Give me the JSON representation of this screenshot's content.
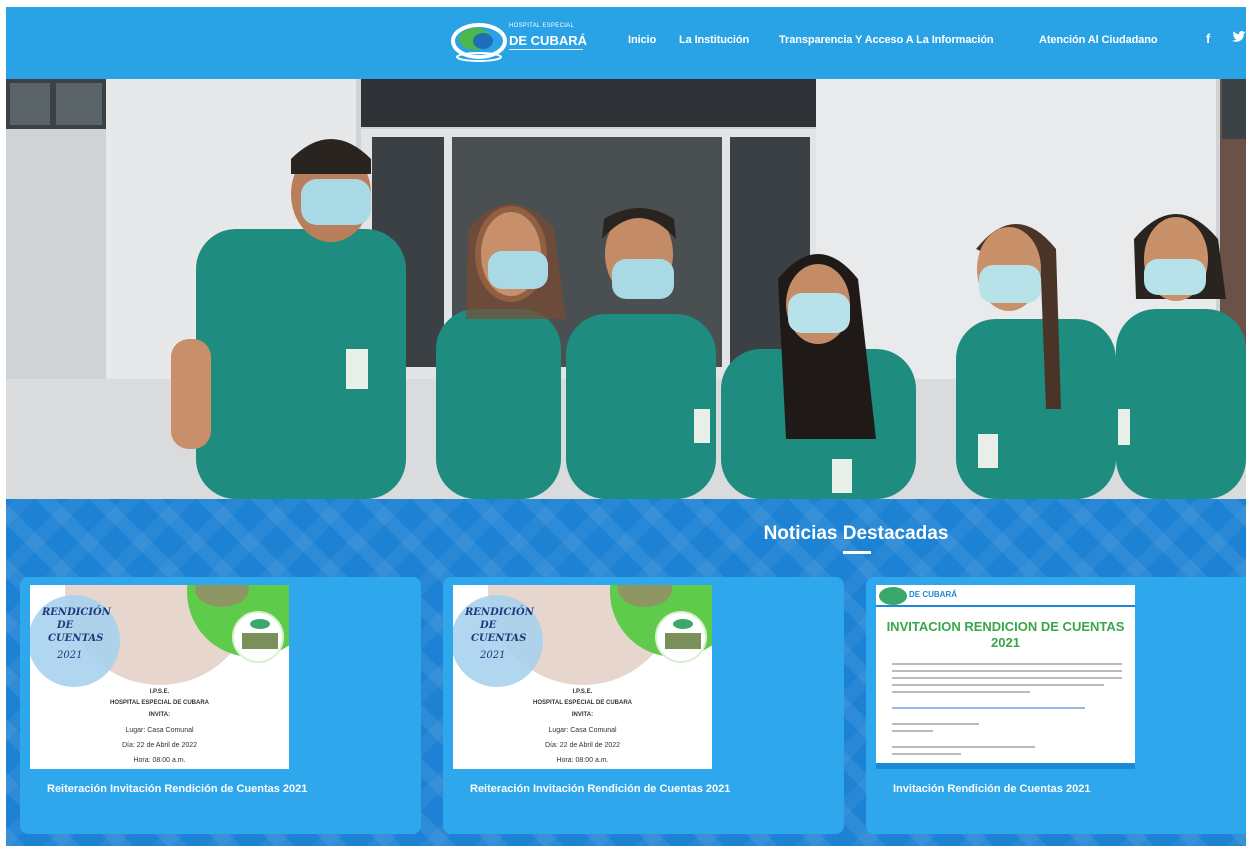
{
  "header": {
    "logo": {
      "line_top": "HOSPITAL ESPECIAL",
      "line_main": "DE CUBARÁ"
    },
    "nav": [
      {
        "label": "Inicio"
      },
      {
        "label": "La Institución"
      },
      {
        "label": "Transparencia Y Acceso A La Información"
      },
      {
        "label": "Atención Al Ciudadano"
      }
    ],
    "social": {
      "facebook": "f",
      "twitter": "🐦"
    }
  },
  "featured": {
    "title": "Noticias Destacadas",
    "cards": [
      {
        "caption": "Reiteración Invitación Rendición de Cuentas 2021",
        "poster": {
          "script": [
            "RENDICIÓN",
            "DE",
            "CUENTAS"
          ],
          "year": "2021",
          "lines": [
            "I.P.S.E.",
            "HOSPITAL ESPECIAL DE CUBARA",
            "INVITA:",
            "Lugar: Casa Comunal",
            "Día: 22 de Abril de 2022",
            "Hora: 08:00 a.m."
          ]
        }
      },
      {
        "caption": "Reiteración Invitación Rendición de Cuentas 2021",
        "poster": {
          "script": [
            "RENDICIÓN",
            "DE",
            "CUENTAS"
          ],
          "year": "2021",
          "lines": [
            "I.P.S.E.",
            "HOSPITAL ESPECIAL DE CUBARA",
            "INVITA:",
            "Lugar: Casa Comunal",
            "Día: 22 de Abril de 2022",
            "Hora: 08:00 a.m."
          ]
        }
      },
      {
        "caption": "Invitación Rendición de Cuentas 2021",
        "invitation": {
          "logo": "DE CUBARÁ",
          "title": "INVITACION RENDICION DE CUENTAS 2021"
        }
      }
    ]
  }
}
